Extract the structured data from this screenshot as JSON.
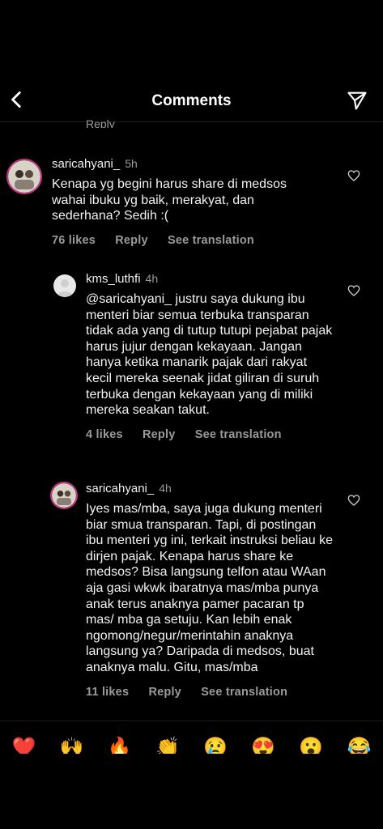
{
  "header": {
    "title": "Comments"
  },
  "cut_off_reply": "Reply",
  "comments": [
    {
      "username": "saricahyani_",
      "time": "5h",
      "text": "Kenapa yg begini harus share di medsos wahai ibuku yg baik, merakyat, dan sederhana? Sedih :(",
      "likes": "76 likes",
      "reply": "Reply",
      "translate": "See translation"
    },
    {
      "username": "kms_luthfi",
      "time": "4h",
      "text": "@saricahyani_ justru saya dukung ibu menteri biar semua terbuka transparan tidak ada yang di tutup tutupi pejabat pajak harus jujur dengan kekayaan. Jangan hanya ketika manarik pajak dari rakyat kecil mereka seenak jidat giliran di suruh terbuka dengan kekayaan yang di miliki mereka seakan takut.",
      "likes": "4 likes",
      "reply": "Reply",
      "translate": "See translation"
    },
    {
      "username": "saricahyani_",
      "time": "4h",
      "text": "Iyes mas/mba, saya juga dukung menteri biar smua transparan. Tapi, di postingan ibu menteri yg ini, terkait instruksi beliau ke dirjen pajak. Kenapa harus share ke medsos? Bisa langsung telfon atau WAan aja gasi wkwk ibaratnya mas/mba punya anak terus anaknya pamer pacaran tp mas/ mba ga setuju. Kan lebih enak ngomong/negur/merintahin anaknya langsung ya? Daripada di medsos, buat anaknya malu. Gitu, mas/mba",
      "likes": "11 likes",
      "reply": "Reply",
      "translate": "See translation"
    }
  ],
  "emoji_bar": [
    "❤️",
    "🙌",
    "🔥",
    "👏",
    "😢",
    "😍",
    "😮",
    "😂"
  ]
}
